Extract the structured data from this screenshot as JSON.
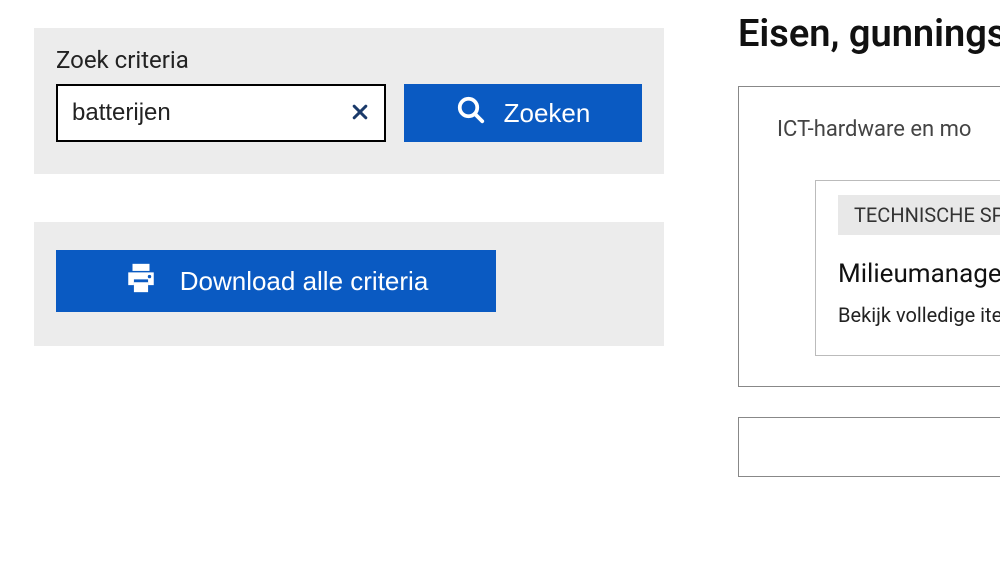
{
  "search": {
    "label": "Zoek criteria",
    "value": "batterijen",
    "button": "Zoeken"
  },
  "download": {
    "button": "Download alle criteria"
  },
  "heading": "Eisen, gunnings",
  "results": {
    "category": "ICT-hardware en mo",
    "tag": "TECHNISCHE SP",
    "item_title": "Milieumanagem",
    "item_sub": "Bekijk volledige item"
  }
}
